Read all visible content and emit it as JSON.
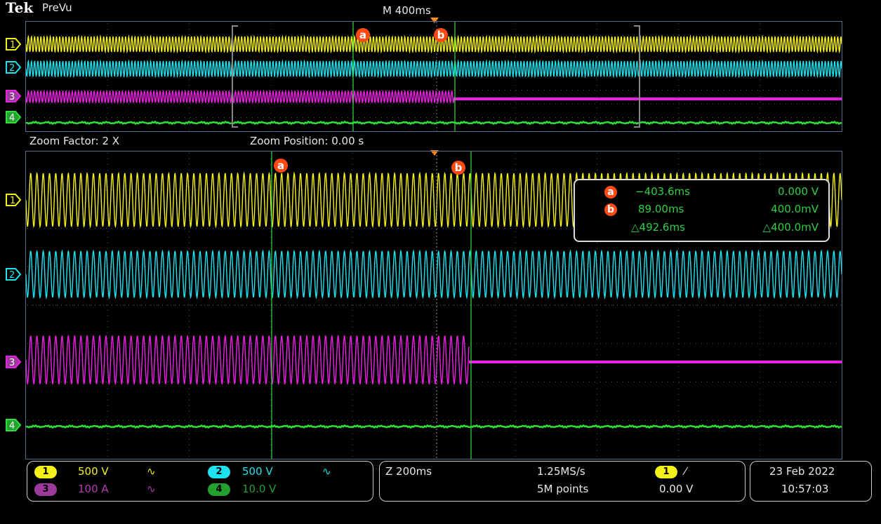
{
  "header": {
    "brand": "Tek",
    "mode": "PreVu",
    "timebase": "M 400ms",
    "zoom_factor": "Zoom Factor: 2 X",
    "zoom_position": "Zoom Position: 0.00 s"
  },
  "channels": [
    {
      "id": "1",
      "color": "#f3f01a",
      "scale": "500 V",
      "coupling": "∿"
    },
    {
      "id": "2",
      "color": "#1ee3ee",
      "scale": "500 V",
      "coupling": "∿"
    },
    {
      "id": "3",
      "color": "#ee1ee6",
      "scale": "100 A",
      "coupling": "∿",
      "label_color": "#9c3a9c"
    },
    {
      "id": "4",
      "color": "#2ee03c",
      "scale": "10.0 V",
      "coupling": "",
      "label_color": "#23a02e"
    }
  ],
  "cursors": {
    "a_label": "a",
    "b_label": "b",
    "a_time": "−403.6ms",
    "a_value": "0.000 V",
    "b_time": "89.00ms",
    "b_value": "400.0mV",
    "delta_time": "△492.6ms",
    "delta_value": "△400.0mV",
    "color": "#ff4a16"
  },
  "status": {
    "zoom_timebase": "Z 200ms",
    "sample_rate": "1.25MS/s",
    "record_length": "5M points",
    "trigger_source": "1",
    "trigger_slope": "⁄",
    "trigger_level": "0.00 V",
    "date": "23 Feb  2022",
    "time": "10:57:03"
  }
}
